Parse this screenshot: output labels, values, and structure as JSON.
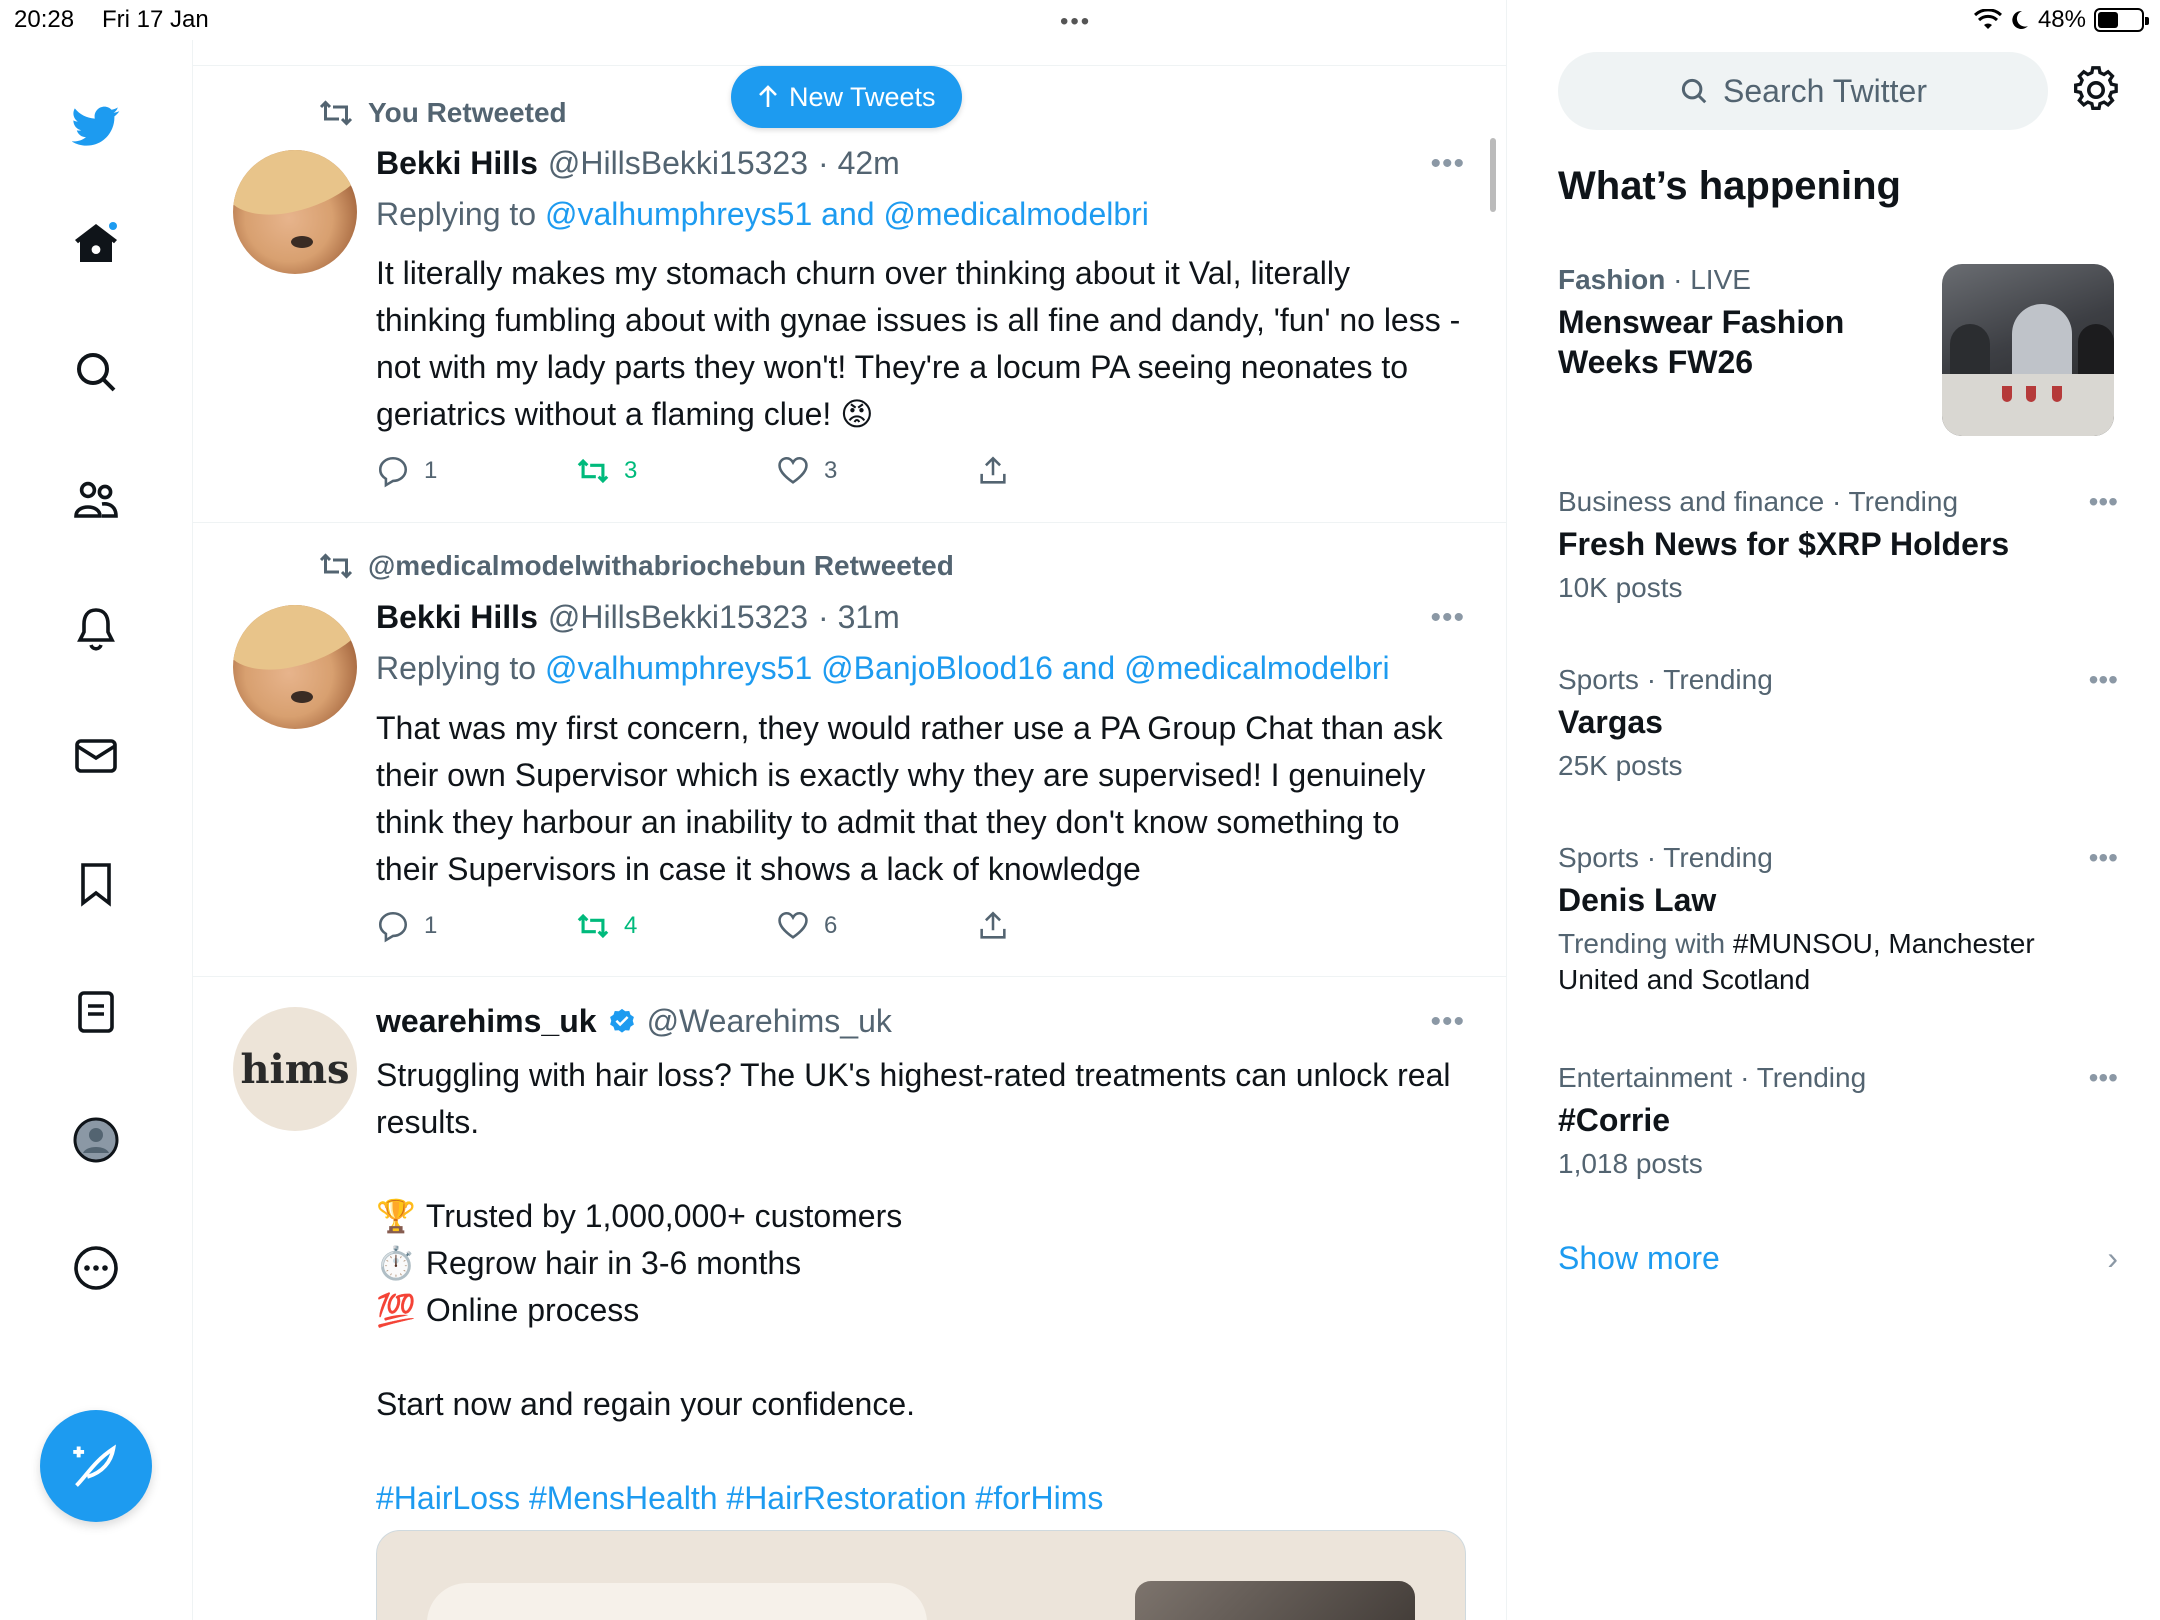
{
  "status_bar": {
    "time": "20:28",
    "date": "Fri 17 Jan",
    "battery": "48%",
    "battery_level": 0.48
  },
  "nav": {
    "items": [
      "home",
      "explore",
      "communities",
      "notifications",
      "messages",
      "bookmarks",
      "lists",
      "profile",
      "more"
    ]
  },
  "new_tweets_label": "New Tweets",
  "tweets": [
    {
      "retweeted_by": "You Retweeted",
      "name": "Bekki Hills",
      "handle": "@HillsBekki15323",
      "time": "· 42m",
      "replying_prefix": "Replying to",
      "replying_to": "@valhumphreys51 and @medicalmodelbri",
      "text": "It literally makes my stomach churn over thinking about it Val, literally thinking fumbling about with gynae issues is all fine and dandy, 'fun' no less - not with my lady parts they won't! They're a locum PA seeing neonates to geriatrics without a flaming clue! 😡",
      "replies": "1",
      "retweets": "3",
      "likes": "3"
    },
    {
      "retweeted_by": "@medicalmodelwithabriochebun Retweeted",
      "name": "Bekki Hills",
      "handle": "@HillsBekki15323",
      "time": "· 31m",
      "replying_prefix": "Replying to",
      "replying_to": "@valhumphreys51 @BanjoBlood16 and @medicalmodelbri",
      "text": "That was my first concern, they would rather use a PA Group Chat than ask their own Supervisor which is exactly why they are supervised! I genuinely think they harbour an inability to admit that they don't know something to their Supervisors in case it shows a lack of knowledge",
      "replies": "1",
      "retweets": "4",
      "likes": "6"
    },
    {
      "avatar_text": "hims",
      "name": "wearehims_uk",
      "handle": "@Wearehims_uk",
      "text_intro": "Struggling with hair loss? The UK's highest-rated treatments can unlock real results.",
      "bullets": [
        {
          "emoji": "🏆",
          "text": "Trusted by 1,000,000+ customers"
        },
        {
          "emoji": "⏱️",
          "text": "Regrow hair in 3-6 months"
        },
        {
          "emoji": "💯",
          "text": "Online process"
        }
      ],
      "cta": "Start now and regain your confidence.",
      "hashtags": "#HairLoss #MensHealth #HairRestoration #forHims"
    }
  ],
  "sidebar": {
    "search_placeholder": "Search Twitter",
    "whats_happening": "What’s happening",
    "trends": [
      {
        "category": "Fashion",
        "tag": "· LIVE",
        "topic": "Menswear Fashion Weeks FW26"
      },
      {
        "category": "Business and finance · Trending",
        "topic": "Fresh News for $XRP Holders",
        "posts": "10K posts"
      },
      {
        "category": "Sports · Trending",
        "topic": "Vargas",
        "posts": "25K posts"
      },
      {
        "category": "Sports · Trending",
        "topic": "Denis Law",
        "trending_with_prefix": "Trending with",
        "trending_with": "#MUNSOU, Manchester United and Scotland"
      },
      {
        "category": "Entertainment · Trending",
        "topic": "#Corrie",
        "posts": "1,018 posts"
      }
    ],
    "show_more": "Show more"
  },
  "colors": {
    "accent": "#1d9bf0",
    "retweet_green": "#00ba7c",
    "secondary_text": "#536471"
  }
}
